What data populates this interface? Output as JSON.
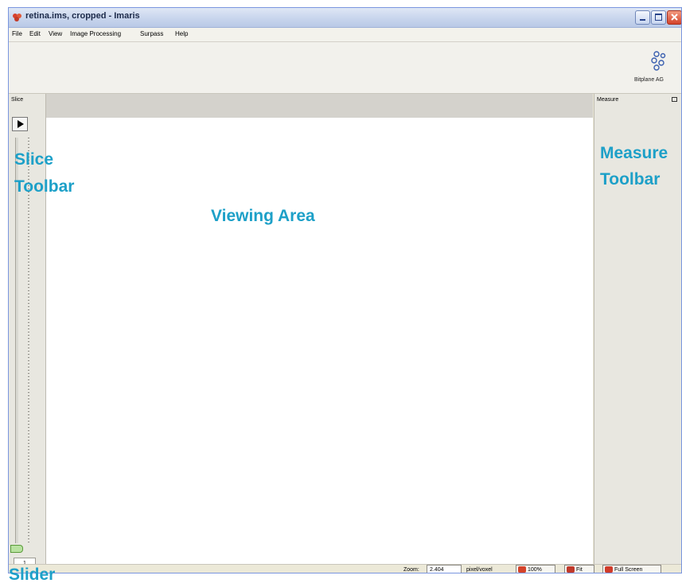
{
  "window": {
    "title": "retina.ims, cropped - Imaris"
  },
  "menu": [
    "File",
    "Edit",
    "View",
    "Image Processing",
    "Surpass",
    "Help"
  ],
  "toolbar": {
    "logo_label": "Bitplane AG"
  },
  "slice_panel": {
    "header": "Slice",
    "play_icon": "play-icon",
    "slice_value": "1"
  },
  "measure_panel": {
    "header": "Measure"
  },
  "statusbar": {
    "zoom_label": "Zoom:",
    "zoom_value": "2.404",
    "unit_label": "pixel/voxel",
    "btn_100": "100%",
    "btn_fit": "Fit",
    "btn_fullscreen": "Full Screen"
  },
  "annotations": {
    "slice_toolbar_1": "Slice",
    "slice_toolbar_2": "Toolbar",
    "viewing_area": "Viewing Area",
    "measure_toolbar_1": "Measure",
    "measure_toolbar_2": "Toolbar",
    "slider": "Slider"
  },
  "colors": {
    "annotation": "#1da0c8",
    "close_button": "#d4432a",
    "title_gradient": "#c6d3ec"
  }
}
